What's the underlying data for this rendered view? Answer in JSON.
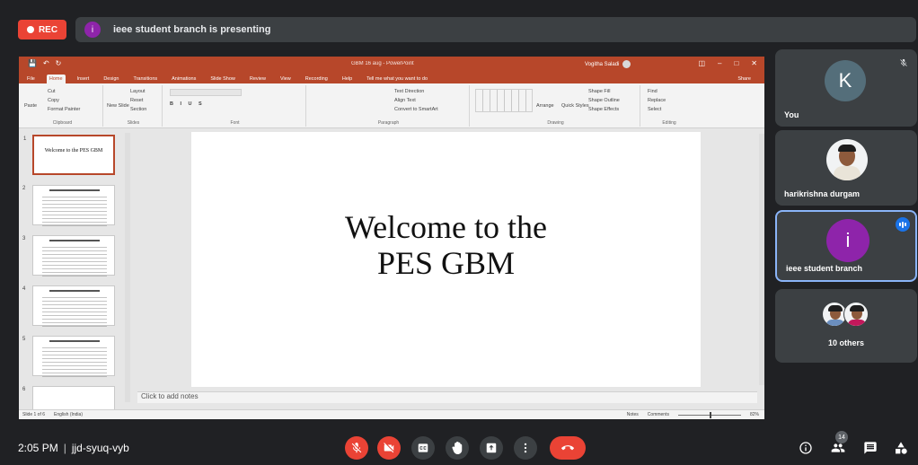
{
  "meet": {
    "rec_label": "REC",
    "presenter_initial": "i",
    "presenting_text": "ieee student branch is presenting"
  },
  "ppt": {
    "window_title": "GBM 16 aug - PowerPoint",
    "user_name": "Vogitha Saladi",
    "tabs": [
      "File",
      "Home",
      "Insert",
      "Design",
      "Transitions",
      "Animations",
      "Slide Show",
      "Review",
      "View",
      "Recording",
      "Help",
      "Tell me what you want to do"
    ],
    "share_label": "Share",
    "ribbon": {
      "clipboard": {
        "label": "Clipboard",
        "paste": "Paste",
        "cut": "Cut",
        "copy": "Copy",
        "format_painter": "Format Painter"
      },
      "slides": {
        "label": "Slides",
        "new_slide": "New Slide",
        "layout": "Layout",
        "reset": "Reset",
        "section": "Section"
      },
      "font": {
        "label": "Font"
      },
      "paragraph": {
        "label": "Paragraph",
        "text_direction": "Text Direction",
        "align_text": "Align Text",
        "smartart": "Convert to SmartArt"
      },
      "drawing": {
        "label": "Drawing",
        "arrange": "Arrange",
        "quick_styles": "Quick Styles",
        "shape_fill": "Shape Fill",
        "shape_outline": "Shape Outline",
        "shape_effects": "Shape Effects"
      },
      "editing": {
        "label": "Editing",
        "find": "Find",
        "replace": "Replace",
        "select": "Select"
      }
    },
    "slides": [
      {
        "num": "1",
        "title": "Welcome to the PES GBM"
      },
      {
        "num": "2",
        "title": ""
      },
      {
        "num": "3",
        "title": ""
      },
      {
        "num": "4",
        "title": ""
      },
      {
        "num": "5",
        "title": ""
      },
      {
        "num": "6",
        "title": ""
      }
    ],
    "current_slide": {
      "line1": "Welcome to the",
      "line2": "PES GBM"
    },
    "notes_placeholder": "Click to add notes",
    "status": {
      "slide_of": "Slide 1 of 6",
      "language": "English (India)",
      "notes": "Notes",
      "comments": "Comments",
      "zoom": "82%"
    }
  },
  "participants": [
    {
      "initial": "K",
      "name": "You",
      "avatar_color": "#546e7a"
    },
    {
      "name": "harikrishna durgam"
    },
    {
      "initial": "i",
      "name": "ieee student branch",
      "avatar_color": "#8e24aa"
    },
    {
      "name": "10 others"
    }
  ],
  "bottom": {
    "time": "2:05 PM",
    "meeting_code": "jjd-syuq-vyb",
    "people_count": "14"
  },
  "icons": [
    "mic-off-icon",
    "camera-off-icon",
    "captions-icon",
    "raise-hand-icon",
    "present-icon",
    "more-options-icon",
    "end-call-icon",
    "info-icon",
    "people-icon",
    "chat-icon",
    "activities-icon"
  ],
  "colors": {
    "accent_red": "#ea4335",
    "ppt_brand": "#b7472a",
    "presenter_purple": "#8e24aa",
    "speaking_blue": "#1a73e8"
  }
}
